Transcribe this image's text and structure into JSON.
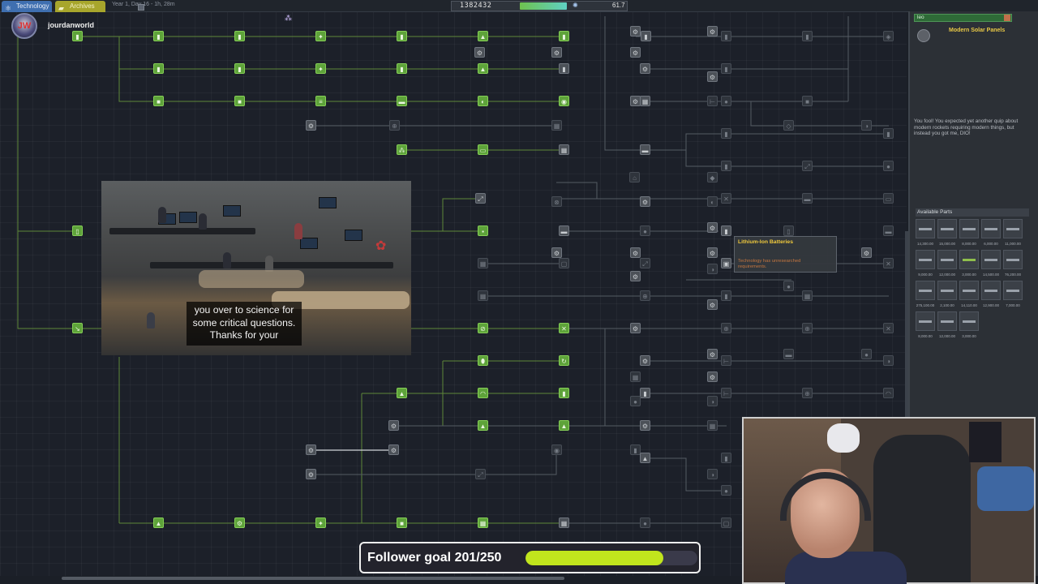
{
  "topbar": {
    "tabs": [
      {
        "label": "Technology",
        "icon": "atom-icon"
      },
      {
        "label": "Archives",
        "icon": "folder-icon"
      }
    ],
    "date": "Year 1, Day 16 - 1h, 28m",
    "funds": "1382432",
    "science": "61.7"
  },
  "stream": {
    "channel": "jourdanworld",
    "caption": "you over to science for some critical questions. Thanks for your",
    "follower_goal_label": "Follower goal 201/250",
    "follower_goal": {
      "current": 201,
      "target": 250
    }
  },
  "panel": {
    "header": "leo",
    "tech_title": "Modern Solar Panels",
    "description": "You fool! You expected yet another quip about modern rockets requiring modern things, but instead you got me, DIO!",
    "available_parts_label": "Available Parts",
    "parts": [
      {
        "cost": "14,300.00"
      },
      {
        "cost": "15,000.00"
      },
      {
        "cost": "8,000.00"
      },
      {
        "cost": "6,000.00"
      },
      {
        "cost": "11,000.00"
      },
      {
        "cost": "9,000.00"
      },
      {
        "cost": "12,000.00"
      },
      {
        "cost": "3,000.00"
      },
      {
        "cost": "14,500.00"
      },
      {
        "cost": "76,200.00"
      },
      {
        "cost": "275,100.00"
      },
      {
        "cost": "2,100.00"
      },
      {
        "cost": "14,110.00"
      },
      {
        "cost": "12,900.00"
      },
      {
        "cost": "7,000.00"
      },
      {
        "cost": "8,000.00"
      },
      {
        "cost": "12,000.00"
      },
      {
        "cost": "3,000.00"
      }
    ]
  },
  "tooltip": {
    "title": "Lithium-Ion Batteries",
    "message": "Technology has unresearched requirements."
  },
  "colors": {
    "researched": "#5ea33a",
    "accent_yellow": "#e9c946",
    "goal_fill": "#c1e51d"
  }
}
